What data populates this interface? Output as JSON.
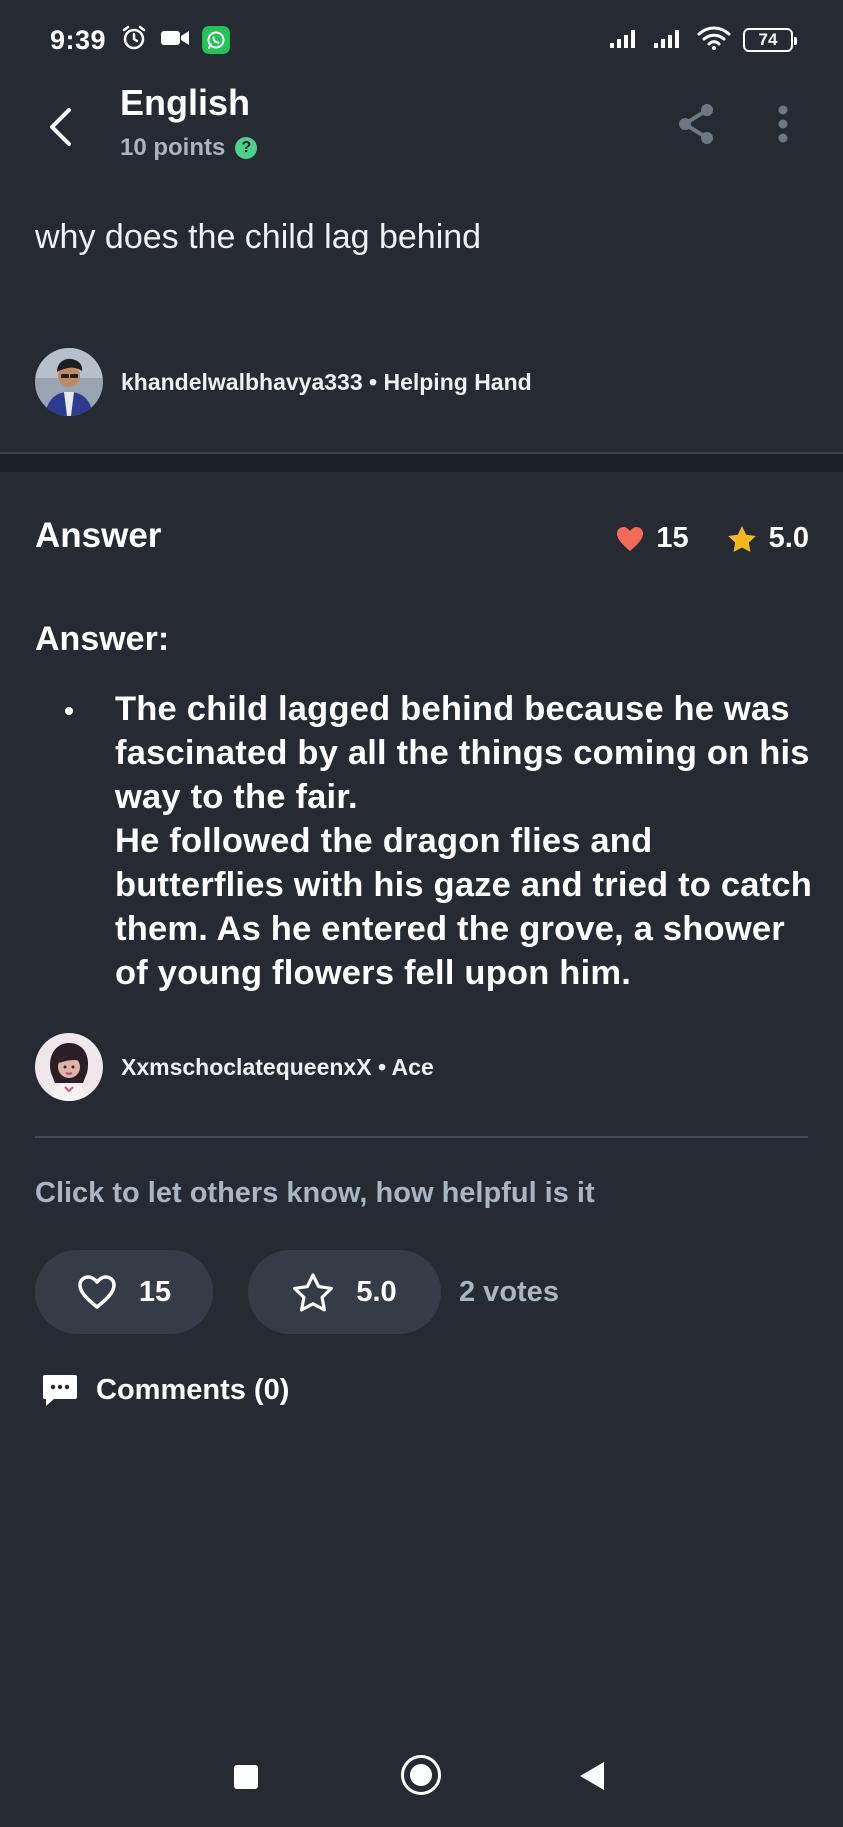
{
  "status_bar": {
    "time": "9:39",
    "battery": "74",
    "icons": [
      "alarm-icon",
      "video-icon",
      "whatsapp-icon",
      "signal-icon",
      "signal-icon",
      "wifi-icon",
      "battery-icon"
    ]
  },
  "header": {
    "subject": "English",
    "points": "10 points",
    "help_glyph": "?"
  },
  "question": {
    "text": "why does the child lag behind",
    "asker_username": "khandelwalbhavya333",
    "asker_rank": "Helping Hand"
  },
  "answer": {
    "section_title": "Answer",
    "likes": "15",
    "rating": "5.0",
    "heading": "Answer:",
    "bullet_paragraphs": [
      "The child lagged behind because he was fascinated by all the things coming on his way to the fair.",
      "He followed the dragon flies and butterflies with his gaze and tried to catch them. As he entered the grove, a shower of young flowers fell upon him."
    ],
    "answerer_username": "XxmschoclatequeenxX",
    "answerer_rank": "Ace"
  },
  "feedback": {
    "prompt": "Click to let others know, how helpful is it",
    "like_count": "15",
    "rating_value": "5.0",
    "votes": "2 votes"
  },
  "comments": {
    "label": "Comments (0)"
  },
  "colors": {
    "background": "#262a33",
    "heart": "#f26b5b",
    "star": "#f5b71f",
    "badge": "#4fd18b"
  }
}
